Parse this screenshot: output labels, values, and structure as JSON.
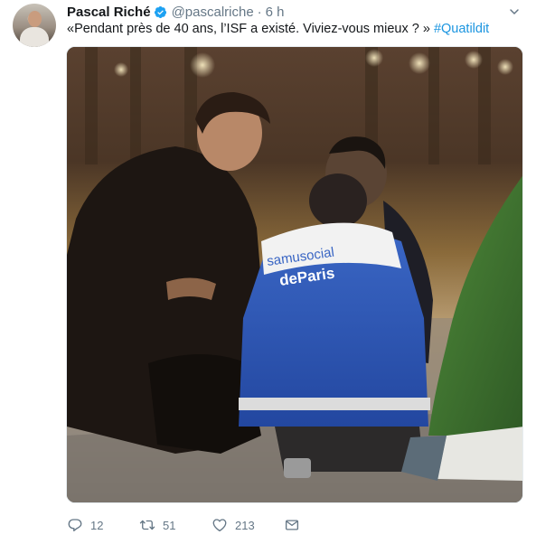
{
  "tweet": {
    "author_name": "Pascal Riché",
    "handle": "@pascalriche",
    "separator": "·",
    "time": "6 h",
    "text": "«Pendant près de 40 ans, l’ISF a existé. Viviez-vous mieux ? » ",
    "hashtag": "#Quatildit",
    "vest_text_line1": "samusocial",
    "vest_text_line2": "deParis",
    "actions": {
      "replies": "12",
      "retweets": "51",
      "likes": "213"
    }
  },
  "colors": {
    "link": "#1b95e0",
    "secondary_text": "#657786",
    "verified_badge": "#1da1f2"
  },
  "icons": {
    "verified": "verified-badge-icon",
    "menu": "chevron-down-icon",
    "reply": "reply-bubble-icon",
    "retweet": "retweet-icon",
    "like": "heart-icon",
    "message": "envelope-icon"
  }
}
